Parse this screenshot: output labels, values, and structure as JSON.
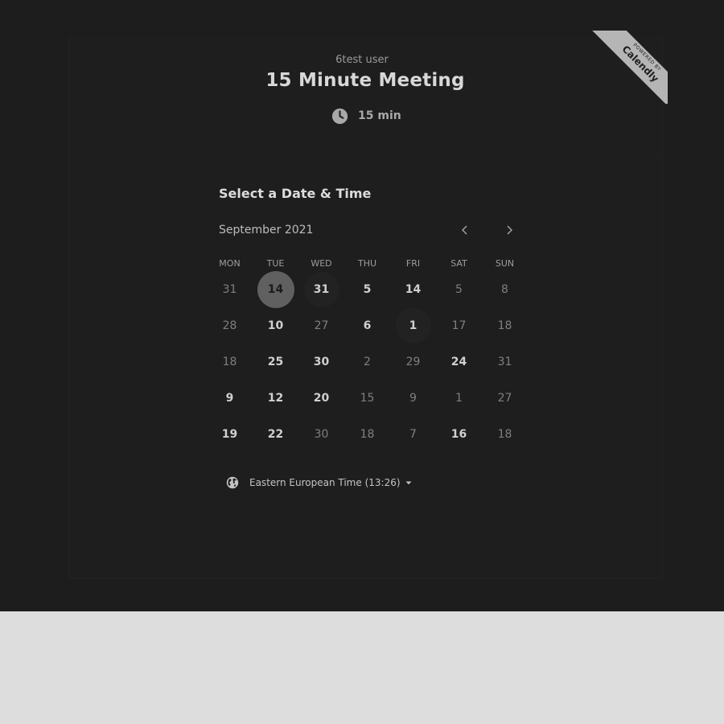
{
  "event": {
    "owner": "6test user",
    "title": "15 Minute Meeting",
    "duration": "15 min"
  },
  "badge": {
    "small": "POWERED BY",
    "brand": "Calendly"
  },
  "calendar": {
    "heading": "Select a Date & Time",
    "month": "September 2021",
    "weekdays": [
      "MON",
      "TUE",
      "WED",
      "THU",
      "FRI",
      "SAT",
      "SUN"
    ],
    "weeks": [
      [
        {
          "d": "31",
          "s": "normal"
        },
        {
          "d": "14",
          "s": "selected"
        },
        {
          "d": "31",
          "s": "available"
        },
        {
          "d": "5",
          "s": "available"
        },
        {
          "d": "14",
          "s": "available"
        },
        {
          "d": "5",
          "s": "normal"
        },
        {
          "d": "8",
          "s": "normal"
        }
      ],
      [
        {
          "d": "28",
          "s": "normal"
        },
        {
          "d": "10",
          "s": "available"
        },
        {
          "d": "27",
          "s": "normal"
        },
        {
          "d": "6",
          "s": "available"
        },
        {
          "d": "1",
          "s": "available"
        },
        {
          "d": "17",
          "s": "normal"
        },
        {
          "d": "18",
          "s": "normal"
        }
      ],
      [
        {
          "d": "18",
          "s": "normal"
        },
        {
          "d": "25",
          "s": "available"
        },
        {
          "d": "30",
          "s": "available"
        },
        {
          "d": "2",
          "s": "normal"
        },
        {
          "d": "29",
          "s": "normal"
        },
        {
          "d": "24",
          "s": "available"
        },
        {
          "d": "31",
          "s": "normal"
        }
      ],
      [
        {
          "d": "9",
          "s": "available"
        },
        {
          "d": "12",
          "s": "available"
        },
        {
          "d": "20",
          "s": "available"
        },
        {
          "d": "15",
          "s": "normal"
        },
        {
          "d": "9",
          "s": "normal"
        },
        {
          "d": "1",
          "s": "normal"
        },
        {
          "d": "27",
          "s": "normal"
        }
      ],
      [
        {
          "d": "19",
          "s": "available"
        },
        {
          "d": "22",
          "s": "available"
        },
        {
          "d": "30",
          "s": "normal"
        },
        {
          "d": "18",
          "s": "normal"
        },
        {
          "d": "7",
          "s": "normal"
        },
        {
          "d": "16",
          "s": "available"
        },
        {
          "d": "18",
          "s": "normal"
        }
      ]
    ]
  },
  "timezone": {
    "label": "Eastern European Time (13:26)"
  },
  "icons": {
    "duration": "clock-icon",
    "timezone": "globe-icon",
    "prev": "chevron-left-icon",
    "next": "chevron-right-icon",
    "dropdown": "caret-down-icon"
  },
  "colors": {
    "background": "#1d1d1d",
    "selected_day": "#606060",
    "ribbon": "#b5b5b5"
  }
}
